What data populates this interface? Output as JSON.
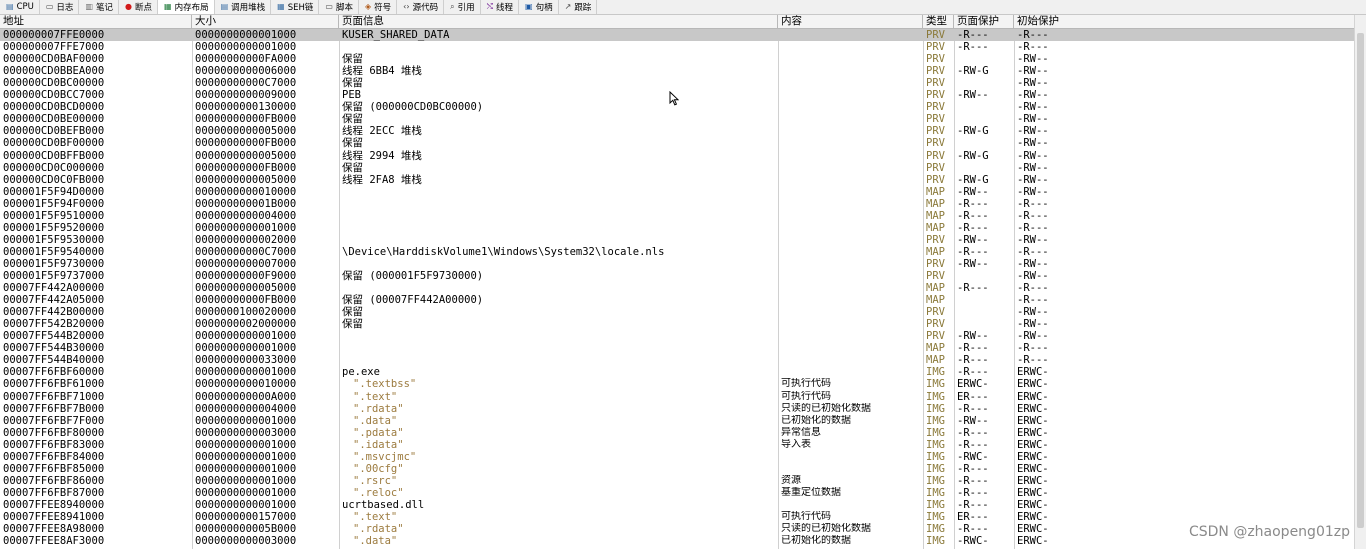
{
  "tabs": [
    {
      "label": "CPU",
      "icon": "cpu-icon",
      "glyph": "▤",
      "color": "#3a6ea5",
      "active": false
    },
    {
      "label": "日志",
      "icon": "log-icon",
      "glyph": "▭",
      "color": "#4a4a4a",
      "active": false
    },
    {
      "label": "笔记",
      "icon": "notes-icon",
      "glyph": "▥",
      "color": "#6a6a6a",
      "active": false
    },
    {
      "label": "断点",
      "icon": "breakpoint-icon",
      "glyph": "●",
      "color": "#d21a1a",
      "active": false
    },
    {
      "label": "内存布局",
      "icon": "memory-map-icon",
      "glyph": "▦",
      "color": "#1e7a3a",
      "active": true
    },
    {
      "label": "调用堆栈",
      "icon": "call-stack-icon",
      "glyph": "▤",
      "color": "#3a6ea5",
      "active": false
    },
    {
      "label": "SEH链",
      "icon": "seh-icon",
      "glyph": "▦",
      "color": "#3a6ea5",
      "active": false
    },
    {
      "label": "脚本",
      "icon": "script-icon",
      "glyph": "▭",
      "color": "#4a4a4a",
      "active": false
    },
    {
      "label": "符号",
      "icon": "symbols-icon",
      "glyph": "◈",
      "color": "#b05a1a",
      "active": false
    },
    {
      "label": "源代码",
      "icon": "source-icon",
      "glyph": "‹›",
      "color": "#3a3a3a",
      "active": false
    },
    {
      "label": "引用",
      "icon": "references-icon",
      "glyph": "⌕",
      "color": "#4a4a4a",
      "active": false
    },
    {
      "label": "线程",
      "icon": "threads-icon",
      "glyph": "⤭",
      "color": "#7a2a9a",
      "active": false
    },
    {
      "label": "句柄",
      "icon": "handles-icon",
      "glyph": "▣",
      "color": "#1e5aa5",
      "active": false
    },
    {
      "label": "跟踪",
      "icon": "trace-icon",
      "glyph": "↗",
      "color": "#4a4a4a",
      "active": false
    }
  ],
  "columns": {
    "address": "地址",
    "size": "大小",
    "info": "页面信息",
    "content": "内容",
    "type": "类型",
    "protection": "页面保护",
    "initial_protection": "初始保护"
  },
  "rows": [
    {
      "address": "000000007FFE0000",
      "size": "0000000000001000",
      "info": "KUSER_SHARED_DATA",
      "content": "",
      "type": "PRV",
      "protection": "-R---",
      "initial": "-R---",
      "selected": true
    },
    {
      "address": "000000007FFE7000",
      "size": "0000000000001000",
      "info": "",
      "content": "",
      "type": "PRV",
      "protection": "-R---",
      "initial": "-R---"
    },
    {
      "address": "000000CD0BAF0000",
      "size": "00000000000FA000",
      "info": "保留",
      "content": "",
      "type": "PRV",
      "protection": "",
      "initial": "-RW--"
    },
    {
      "address": "000000CD0BBEA000",
      "size": "0000000000006000",
      "info": "线程 6BB4 堆栈",
      "content": "",
      "type": "PRV",
      "protection": "-RW-G",
      "initial": "-RW--"
    },
    {
      "address": "000000CD0BC00000",
      "size": "00000000000C7000",
      "info": "保留",
      "content": "",
      "type": "PRV",
      "protection": "",
      "initial": "-RW--"
    },
    {
      "address": "000000CD0BCC7000",
      "size": "0000000000009000",
      "info": "PEB",
      "content": "",
      "type": "PRV",
      "protection": "-RW--",
      "initial": "-RW--"
    },
    {
      "address": "000000CD0BCD0000",
      "size": "0000000000130000",
      "info": "保留 (000000CD0BC00000)",
      "content": "",
      "type": "PRV",
      "protection": "",
      "initial": "-RW--"
    },
    {
      "address": "000000CD0BE00000",
      "size": "00000000000FB000",
      "info": "保留",
      "content": "",
      "type": "PRV",
      "protection": "",
      "initial": "-RW--"
    },
    {
      "address": "000000CD0BEFB000",
      "size": "0000000000005000",
      "info": "线程 2ECC 堆栈",
      "content": "",
      "type": "PRV",
      "protection": "-RW-G",
      "initial": "-RW--"
    },
    {
      "address": "000000CD0BF00000",
      "size": "00000000000FB000",
      "info": "保留",
      "content": "",
      "type": "PRV",
      "protection": "",
      "initial": "-RW--"
    },
    {
      "address": "000000CD0BFFB000",
      "size": "0000000000005000",
      "info": "线程 2994 堆栈",
      "content": "",
      "type": "PRV",
      "protection": "-RW-G",
      "initial": "-RW--"
    },
    {
      "address": "000000CD0C000000",
      "size": "00000000000FB000",
      "info": "保留",
      "content": "",
      "type": "PRV",
      "protection": "",
      "initial": "-RW--"
    },
    {
      "address": "000000CD0C0FB000",
      "size": "0000000000005000",
      "info": "线程 2FA8 堆栈",
      "content": "",
      "type": "PRV",
      "protection": "-RW-G",
      "initial": "-RW--"
    },
    {
      "address": "000001F5F94D0000",
      "size": "0000000000010000",
      "info": "",
      "content": "",
      "type": "MAP",
      "protection": "-RW--",
      "initial": "-RW--"
    },
    {
      "address": "000001F5F94F0000",
      "size": "000000000001B000",
      "info": "",
      "content": "",
      "type": "MAP",
      "protection": "-R---",
      "initial": "-R---"
    },
    {
      "address": "000001F5F9510000",
      "size": "0000000000004000",
      "info": "",
      "content": "",
      "type": "MAP",
      "protection": "-R---",
      "initial": "-R---"
    },
    {
      "address": "000001F5F9520000",
      "size": "0000000000001000",
      "info": "",
      "content": "",
      "type": "MAP",
      "protection": "-R---",
      "initial": "-R---"
    },
    {
      "address": "000001F5F9530000",
      "size": "0000000000002000",
      "info": "",
      "content": "",
      "type": "PRV",
      "protection": "-RW--",
      "initial": "-RW--"
    },
    {
      "address": "000001F5F9540000",
      "size": "00000000000C7000",
      "info": "\\Device\\HarddiskVolume1\\Windows\\System32\\locale.nls",
      "content": "",
      "type": "MAP",
      "protection": "-R---",
      "initial": "-R---"
    },
    {
      "address": "000001F5F9730000",
      "size": "0000000000007000",
      "info": "",
      "content": "",
      "type": "PRV",
      "protection": "-RW--",
      "initial": "-RW--"
    },
    {
      "address": "000001F5F9737000",
      "size": "00000000000F9000",
      "info": "保留 (000001F5F9730000)",
      "content": "",
      "type": "PRV",
      "protection": "",
      "initial": "-RW--"
    },
    {
      "address": "00007FF442A00000",
      "size": "0000000000005000",
      "info": "",
      "content": "",
      "type": "MAP",
      "protection": "-R---",
      "initial": "-R---"
    },
    {
      "address": "00007FF442A05000",
      "size": "00000000000FB000",
      "info": "保留 (00007FF442A00000)",
      "content": "",
      "type": "MAP",
      "protection": "",
      "initial": "-R---"
    },
    {
      "address": "00007FF442B00000",
      "size": "0000000100020000",
      "info": "保留",
      "content": "",
      "type": "PRV",
      "protection": "",
      "initial": "-RW--"
    },
    {
      "address": "00007FF542B20000",
      "size": "0000000002000000",
      "info": "保留",
      "content": "",
      "type": "PRV",
      "protection": "",
      "initial": "-RW--"
    },
    {
      "address": "00007FF544B20000",
      "size": "0000000000001000",
      "info": "",
      "content": "",
      "type": "PRV",
      "protection": "-RW--",
      "initial": "-RW--"
    },
    {
      "address": "00007FF544B30000",
      "size": "0000000000001000",
      "info": "",
      "content": "",
      "type": "MAP",
      "protection": "-R---",
      "initial": "-R---"
    },
    {
      "address": "00007FF544B40000",
      "size": "0000000000033000",
      "info": "",
      "content": "",
      "type": "MAP",
      "protection": "-R---",
      "initial": "-R---"
    },
    {
      "address": "00007FF6FBF60000",
      "size": "0000000000001000",
      "info": "pe.exe",
      "content": "",
      "type": "IMG",
      "protection": "-R---",
      "initial": "ERWC-"
    },
    {
      "address": "00007FF6FBF61000",
      "size": "0000000000010000",
      "info": "\".textbss\"",
      "section": true,
      "content": "可执行代码",
      "type": "IMG",
      "protection": "ERWC-",
      "initial": "ERWC-"
    },
    {
      "address": "00007FF6FBF71000",
      "size": "000000000000A000",
      "info": "\".text\"",
      "section": true,
      "content": "可执行代码",
      "type": "IMG",
      "protection": "ER---",
      "initial": "ERWC-"
    },
    {
      "address": "00007FF6FBF7B000",
      "size": "0000000000004000",
      "info": "\".rdata\"",
      "section": true,
      "content": "只读的已初始化数据",
      "type": "IMG",
      "protection": "-R---",
      "initial": "ERWC-"
    },
    {
      "address": "00007FF6FBF7F000",
      "size": "0000000000001000",
      "info": "\".data\"",
      "section": true,
      "content": "已初始化的数据",
      "type": "IMG",
      "protection": "-RW--",
      "initial": "ERWC-"
    },
    {
      "address": "00007FF6FBF80000",
      "size": "0000000000003000",
      "info": "\".pdata\"",
      "section": true,
      "content": "异常信息",
      "type": "IMG",
      "protection": "-R---",
      "initial": "ERWC-"
    },
    {
      "address": "00007FF6FBF83000",
      "size": "0000000000001000",
      "info": "\".idata\"",
      "section": true,
      "content": "导入表",
      "type": "IMG",
      "protection": "-R---",
      "initial": "ERWC-"
    },
    {
      "address": "00007FF6FBF84000",
      "size": "0000000000001000",
      "info": "\".msvcjmc\"",
      "section": true,
      "content": "",
      "type": "IMG",
      "protection": "-RWC-",
      "initial": "ERWC-"
    },
    {
      "address": "00007FF6FBF85000",
      "size": "0000000000001000",
      "info": "\".00cfg\"",
      "section": true,
      "content": "",
      "type": "IMG",
      "protection": "-R---",
      "initial": "ERWC-"
    },
    {
      "address": "00007FF6FBF86000",
      "size": "0000000000001000",
      "info": "\".rsrc\"",
      "section": true,
      "content": "资源",
      "type": "IMG",
      "protection": "-R---",
      "initial": "ERWC-"
    },
    {
      "address": "00007FF6FBF87000",
      "size": "0000000000001000",
      "info": "\".reloc\"",
      "section": true,
      "content": "基重定位数据",
      "type": "IMG",
      "protection": "-R---",
      "initial": "ERWC-"
    },
    {
      "address": "00007FFEE8940000",
      "size": "0000000000001000",
      "info": "ucrtbased.dll",
      "content": "",
      "type": "IMG",
      "protection": "-R---",
      "initial": "ERWC-"
    },
    {
      "address": "00007FFEE8941000",
      "size": "0000000000157000",
      "info": "\".text\"",
      "section": true,
      "content": "可执行代码",
      "type": "IMG",
      "protection": "ER---",
      "initial": "ERWC-"
    },
    {
      "address": "00007FFEE8A98000",
      "size": "000000000005B000",
      "info": "\".rdata\"",
      "section": true,
      "content": "只读的已初始化数据",
      "type": "IMG",
      "protection": "-R---",
      "initial": "ERWC-"
    },
    {
      "address": "00007FFEE8AF3000",
      "size": "0000000000003000",
      "info": "\".data\"",
      "section": true,
      "content": "已初始化的数据",
      "type": "IMG",
      "protection": "-RWC-",
      "initial": "ERWC-"
    }
  ],
  "watermark": "CSDN @zhaopeng01zp"
}
